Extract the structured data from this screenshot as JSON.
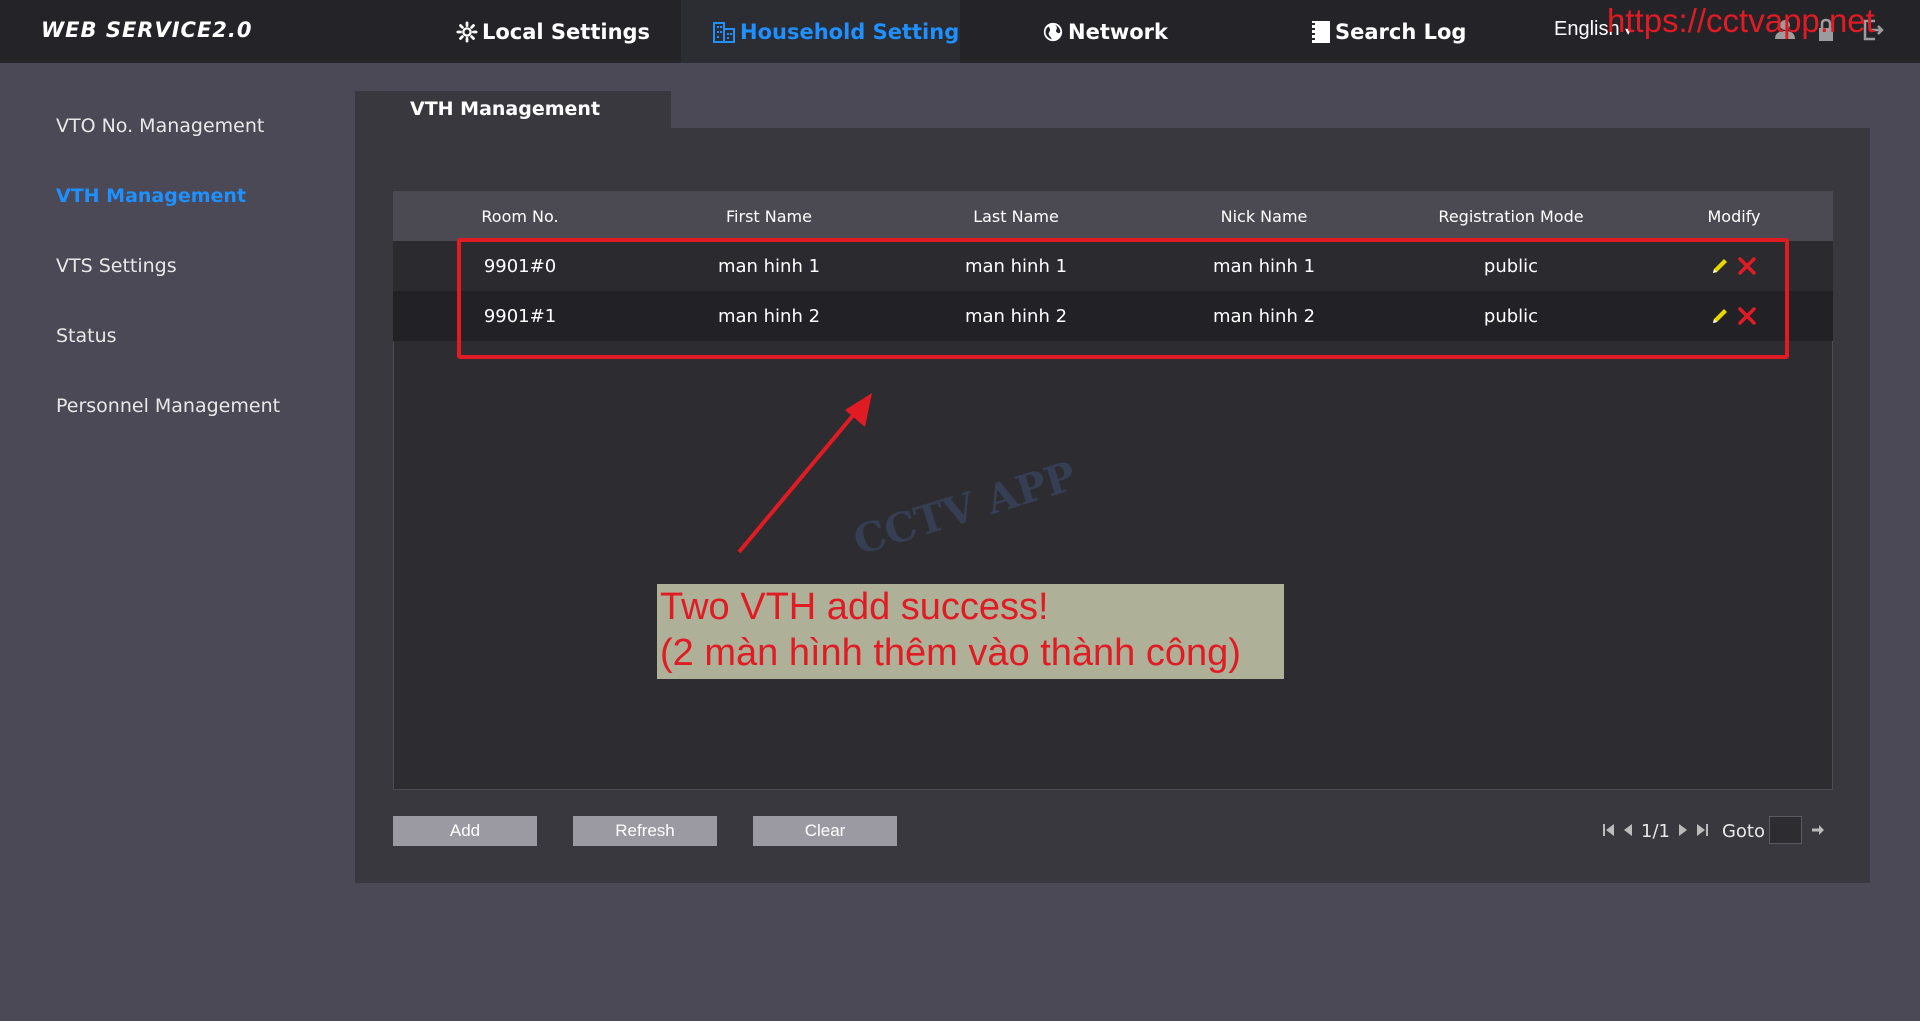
{
  "header": {
    "logo": "WEB SERVICE2.0",
    "nav": [
      {
        "label": "Local Settings",
        "icon": "gear-icon"
      },
      {
        "label": "Household Setting",
        "icon": "building-icon",
        "active": true
      },
      {
        "label": "Network",
        "icon": "globe-icon"
      },
      {
        "label": "Search Log",
        "icon": "log-icon"
      }
    ],
    "language": "English",
    "icons": [
      "user-icon",
      "lock-icon",
      "logout-icon"
    ]
  },
  "watermark_url": "https://cctvapp.net",
  "sidebar": {
    "items": [
      {
        "label": "VTO No. Management"
      },
      {
        "label": "VTH Management",
        "active": true
      },
      {
        "label": "VTS Settings"
      },
      {
        "label": "Status"
      },
      {
        "label": "Personnel Management"
      }
    ]
  },
  "panel": {
    "tab": "VTH Management"
  },
  "table": {
    "columns": [
      "Room No.",
      "First Name",
      "Last Name",
      "Nick Name",
      "Registration Mode",
      "Modify"
    ],
    "rows": [
      [
        "9901#0",
        "man hinh 1",
        "man hinh 1",
        "man hinh 1",
        "public"
      ],
      [
        "9901#1",
        "man hinh 2",
        "man hinh 2",
        "man hinh 2",
        "public"
      ]
    ]
  },
  "annotation": {
    "line1": "Two VTH add success!",
    "line2": "(2 màn hình thêm vào thành công)"
  },
  "center_watermark": "CCTV APP",
  "buttons": {
    "add": "Add",
    "refresh": "Refresh",
    "clear": "Clear"
  },
  "pager": {
    "page": "1/1",
    "goto_label": "Goto",
    "goto_value": ""
  },
  "colors": {
    "accent": "#1e90ff",
    "annotation_red": "#e01b24",
    "edit_icon": "#e8d800"
  }
}
